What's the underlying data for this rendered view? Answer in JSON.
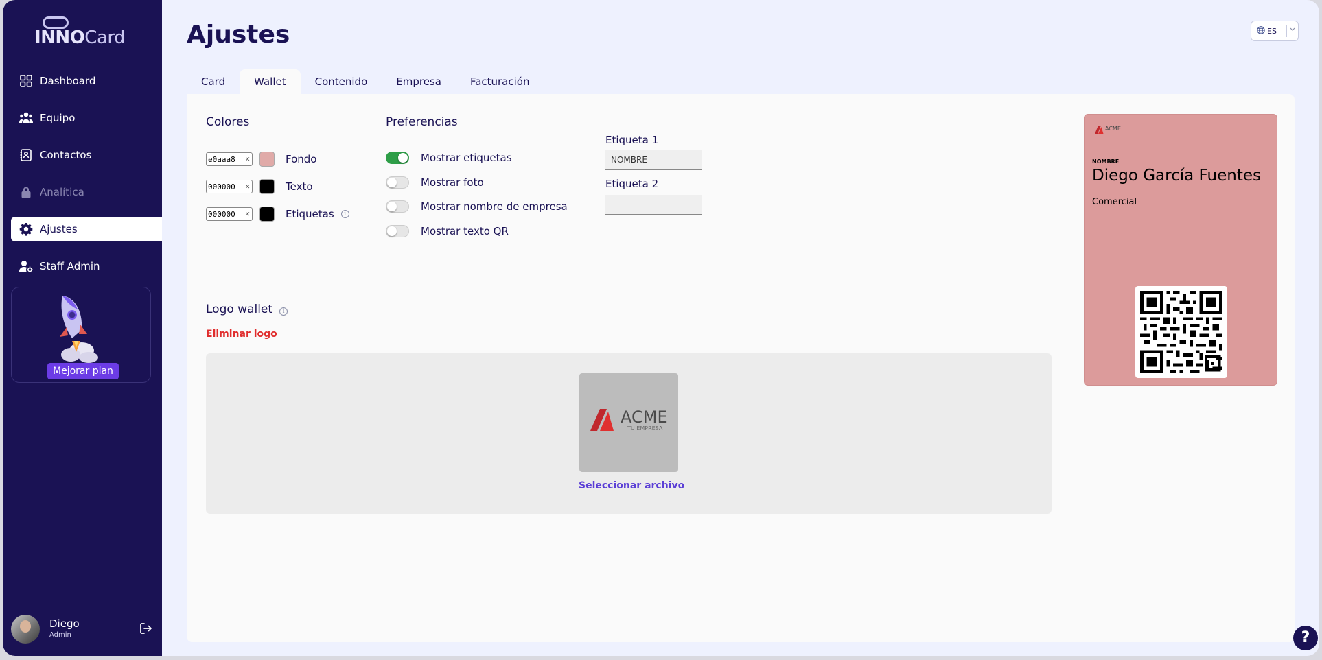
{
  "app": {
    "logo_left": "INNO",
    "logo_right": "Card"
  },
  "sidebar": {
    "items": [
      {
        "label": "Dashboard",
        "icon": "grid-icon"
      },
      {
        "label": "Equipo",
        "icon": "team-icon"
      },
      {
        "label": "Contactos",
        "icon": "contacts-icon"
      },
      {
        "label": "Analítica",
        "icon": "lock-icon"
      },
      {
        "label": "Ajustes",
        "icon": "gear-icon"
      },
      {
        "label": "Staff Admin",
        "icon": "staff-admin-icon"
      }
    ],
    "upgrade_label": "Mejorar plan",
    "user": {
      "name": "Diego",
      "role": "Admin"
    }
  },
  "header": {
    "title": "Ajustes",
    "language": "ES"
  },
  "tabs": [
    "Card",
    "Wallet",
    "Contenido",
    "Empresa",
    "Facturación"
  ],
  "active_tab": "Wallet",
  "colors": {
    "title": "Colores",
    "rows": [
      {
        "value": "e0aaa8",
        "label": "Fondo",
        "swatch": "#e0aaa8"
      },
      {
        "value": "000000",
        "label": "Texto",
        "swatch": "#000000"
      },
      {
        "value": "000000",
        "label": "Etiquetas",
        "swatch": "#000000"
      }
    ]
  },
  "preferences": {
    "title": "Preferencias",
    "toggles": [
      {
        "label": "Mostrar etiquetas",
        "on": true
      },
      {
        "label": "Mostrar foto",
        "on": false
      },
      {
        "label": "Mostrar nombre de empresa",
        "on": false
      },
      {
        "label": "Mostrar texto QR",
        "on": false
      }
    ]
  },
  "labels": {
    "label1_title": "Etiqueta 1",
    "label1_value": "NOMBRE",
    "label2_title": "Etiqueta 2",
    "label2_value": ""
  },
  "logo_wallet": {
    "title": "Logo wallet",
    "remove": "Eliminar logo",
    "select_file": "Seleccionar archivo",
    "logo_text": "ACME",
    "logo_sub": "TU EMPRESA"
  },
  "preview": {
    "logo_text": "ACME",
    "label": "NOMBRE",
    "name": "Diego García Fuentes",
    "role": "Comercial",
    "background": "#dc9b9b"
  },
  "theme": {
    "sidebar_bg": "#1a1254",
    "accent": "#6c3ce6",
    "toggle_on": "#2e9e48",
    "danger": "#e02d2d"
  }
}
